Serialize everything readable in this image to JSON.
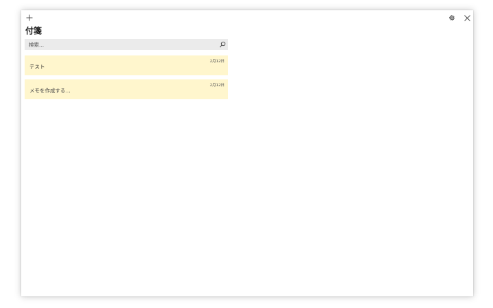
{
  "app": {
    "title": "付箋"
  },
  "titlebar": {
    "add_icon": "plus-icon",
    "settings_icon": "gear-icon",
    "close_icon": "close-icon"
  },
  "search": {
    "placeholder": "検索...",
    "value": "",
    "icon": "search-icon"
  },
  "notes": [
    {
      "date": "2月12日",
      "text": "テスト"
    },
    {
      "date": "2月12日",
      "text": "メモを作成する..."
    }
  ],
  "colors": {
    "note_background": "#fff6cd",
    "search_background": "#ebebeb",
    "window_background": "#ffffff"
  }
}
